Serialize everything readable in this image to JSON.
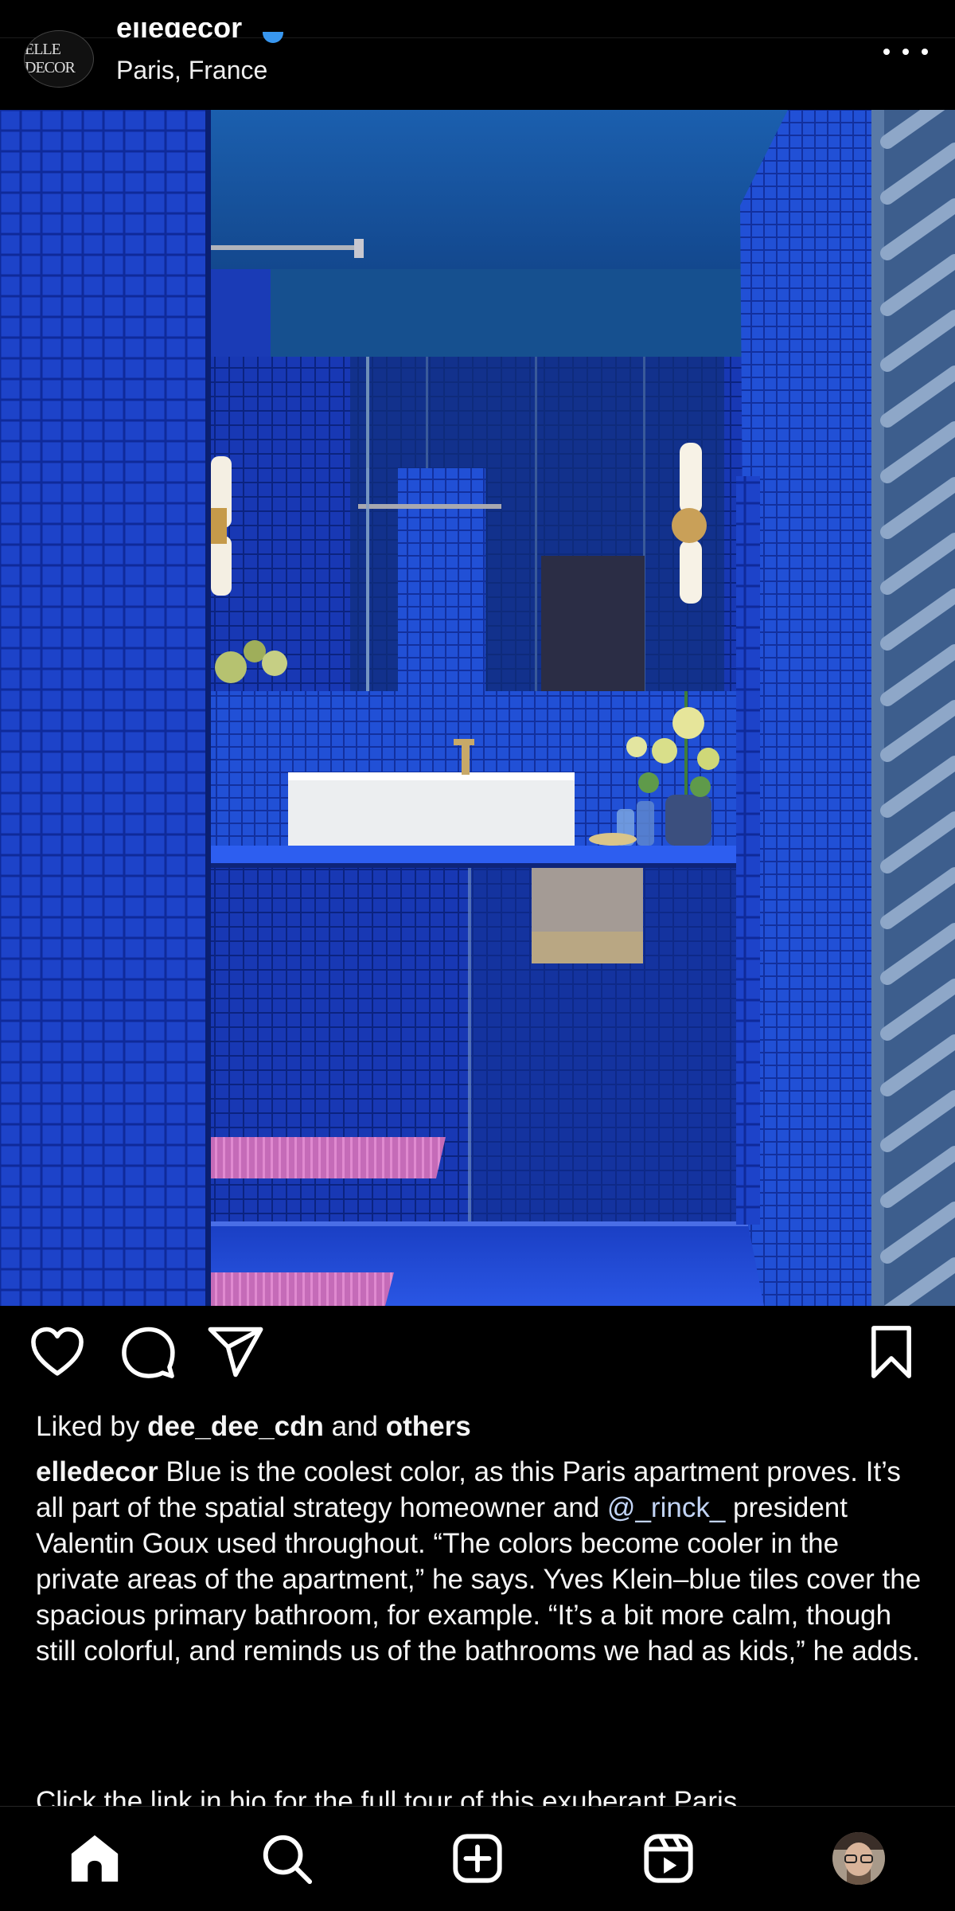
{
  "header": {
    "username": "elledecor",
    "location": "Paris, France",
    "logo_text": "ELLE DECOR"
  },
  "post": {
    "liked_by_prefix": "Liked by",
    "liked_by_user": "dee_dee_cdn",
    "liked_by_and": "and",
    "liked_by_others": "others",
    "caption_user": "elledecor",
    "caption_part1": " Blue is the coolest color, as this Paris apartment proves. It’s all part of the spatial strategy homeowner and ",
    "caption_mention": "@_rinck_",
    "caption_part2": " president Valentin Goux used throughout. “The colors become cooler in the private areas of the apartment,” he says. Yves Klein–blue tiles cover the spacious primary bathroom, for example. “It’s a bit more calm, though still colorful, and reminds us of the bathrooms we had as kids,” he adds.",
    "caption_more": "Click the link in bio for the full tour of this exuberant Paris"
  },
  "icons": {
    "like": "heart-icon",
    "comment": "comment-icon",
    "share": "share-icon",
    "save": "bookmark-icon",
    "more": "more-horizontal-icon",
    "nav_home": "home-icon",
    "nav_search": "search-icon",
    "nav_create": "plus-square-icon",
    "nav_reels": "reels-icon",
    "nav_profile": "profile-avatar"
  },
  "colors": {
    "background": "#000000",
    "text": "#f5f5f5",
    "mention": "#c2d4f5",
    "tile_blue": "#1c3fc8"
  }
}
